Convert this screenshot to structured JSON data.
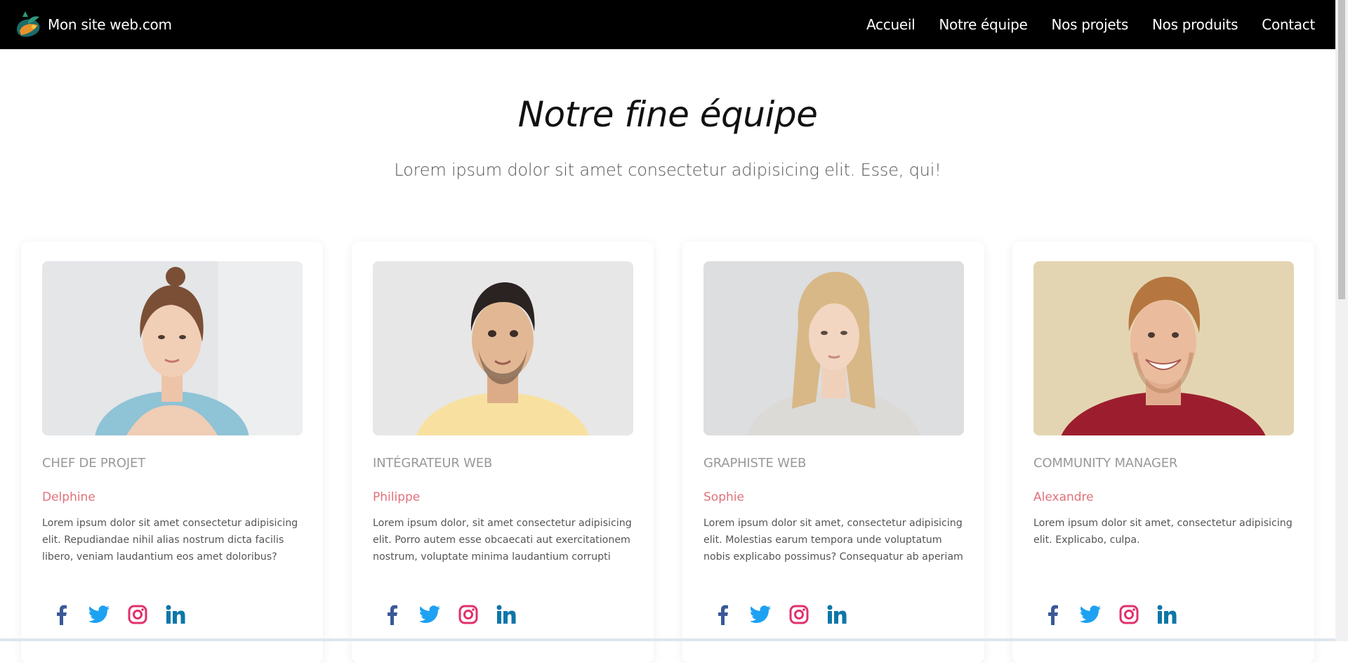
{
  "navbar": {
    "brand": "Mon site web.com",
    "links": [
      "Accueil",
      "Notre équipe",
      "Nos projets",
      "Nos produits",
      "Contact"
    ]
  },
  "hero": {
    "title": "Notre fine équipe",
    "subtitle": "Lorem ipsum dolor sit amet consectetur adipisicing elit. Esse, qui!"
  },
  "team": [
    {
      "role": "CHEF DE PROJET",
      "name": "Delphine",
      "description": "Lorem ipsum dolor sit amet consectetur adipisicing elit. Repudiandae nihil alias nostrum dicta facilis libero, veniam laudantium eos amet doloribus?"
    },
    {
      "role": "INTÉGRATEUR WEB",
      "name": "Philippe",
      "description": "Lorem ipsum dolor, sit amet consectetur adipisicing elit. Porro autem esse obcaecati aut exercitationem nostrum, voluptate minima laudantium corrupti excepturi saepe sed necessitatibus architecto, eius"
    },
    {
      "role": "GRAPHISTE WEB",
      "name": "Sophie",
      "description": "Lorem ipsum dolor sit amet, consectetur adipisicing elit. Molestias earum tempora unde voluptatum nobis explicabo possimus? Consequatur ab aperiam magnam reiciendis? Eos eaque provident magnam"
    },
    {
      "role": "COMMUNITY MANAGER",
      "name": "Alexandre",
      "description": "Lorem ipsum dolor sit amet, consectetur adipisicing elit. Explicabo, culpa."
    }
  ],
  "social_icons": [
    "facebook-icon",
    "twitter-icon",
    "instagram-icon",
    "linkedin-icon"
  ],
  "colors": {
    "navbar_bg": "#000000",
    "name_accent": "#e0717b",
    "facebook": "#3b5998",
    "twitter": "#1da1f2",
    "instagram": "#e1306c",
    "linkedin": "#0e76a8"
  }
}
